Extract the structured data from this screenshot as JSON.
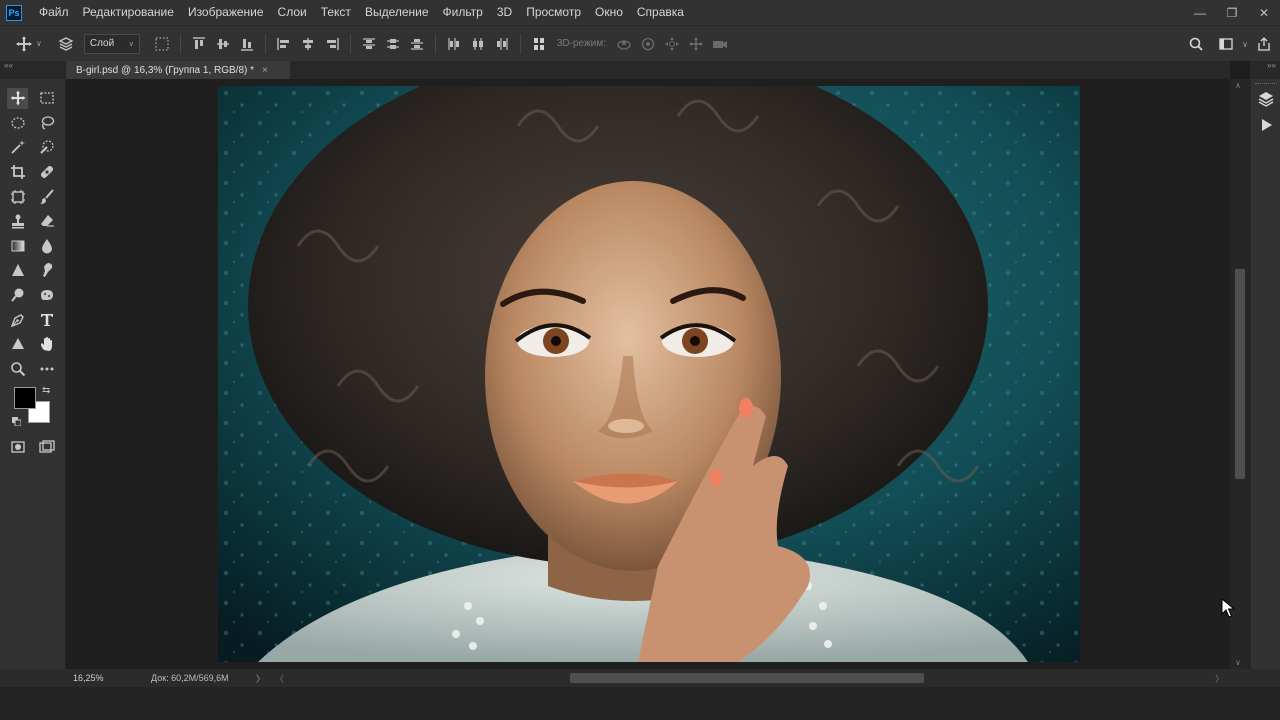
{
  "app": {
    "logo": "Ps"
  },
  "menu": [
    "Файл",
    "Редактирование",
    "Изображение",
    "Слои",
    "Текст",
    "Выделение",
    "Фильтр",
    "3D",
    "Просмотр",
    "Окно",
    "Справка"
  ],
  "window_controls": {
    "minimize": "—",
    "restore": "❐",
    "close": "✕"
  },
  "options": {
    "auto_select_value": "Слой",
    "mode_3d_label": "3D-режим:"
  },
  "document_tab": {
    "title": "B-girl.psd @ 16,3% (Группа 1, RGB/8) *",
    "close": "×"
  },
  "collapse": {
    "left": "««",
    "right": "»»"
  },
  "toolbox": {
    "foreground_color": "#000000",
    "background_color": "#ffffff",
    "tools": [
      "move-tool",
      "rect-marquee-tool",
      "elliptical-marquee-tool",
      "lasso-tool",
      "magic-wand-tool",
      "quick-selection-tool",
      "crop-tool",
      "healing-brush-tool",
      "frame-tool",
      "brush-tool",
      "clone-stamp-tool",
      "eraser-tool",
      "gradient-tool",
      "blur-tool",
      "sharpen-tool",
      "smudge-tool",
      "dodge-tool",
      "sponge-tool",
      "pen-tool",
      "type-tool",
      "shape-tool",
      "hand-tool",
      "zoom-tool",
      "more-tools"
    ]
  },
  "status": {
    "zoom": "16,25%",
    "doc_info": "Док: 60,2M/569,6M",
    "arrow": "〉"
  },
  "scroll": {
    "up": "∧",
    "down": "∨",
    "left": "〈",
    "right": "〉"
  },
  "colors": {
    "menubar_bg": "#323232",
    "canvas_bg": "#1f1f1f",
    "photo_bg": "#0f4a50",
    "accent": "#31a8ff"
  }
}
